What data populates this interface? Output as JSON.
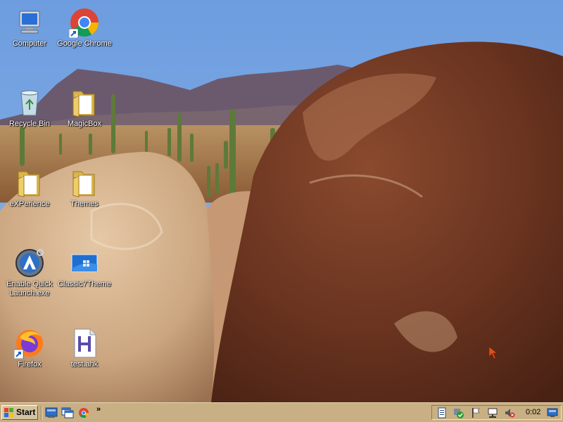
{
  "desktop": {
    "icons": [
      {
        "label": "Computer",
        "icon": "computer-icon"
      },
      {
        "label": "Google Chrome",
        "icon": "chrome-icon"
      },
      {
        "label": "Recycle Bin",
        "icon": "recycle-bin-icon"
      },
      {
        "label": "MagicBox",
        "icon": "folder-icon"
      },
      {
        "label": "eXPerience",
        "icon": "folder-icon"
      },
      {
        "label": "Themes",
        "icon": "folder-icon"
      },
      {
        "label": "Enable Quick\nLaunch.exe",
        "icon": "quick-launch-app-icon"
      },
      {
        "label": "Classic7Theme",
        "icon": "theme-icon"
      },
      {
        "label": "Firefox",
        "icon": "firefox-icon"
      },
      {
        "label": "test.ahk",
        "icon": "ahk-script-icon"
      }
    ]
  },
  "taskbar": {
    "start_label": "Start",
    "quick_launch": [
      "show-desktop-icon",
      "switch-windows-icon",
      "chrome-icon"
    ],
    "quick_launch_more": "»",
    "tray_icons": [
      "document-icon",
      "security-check-icon",
      "flag-icon",
      "network-icon",
      "volume-muted-icon",
      "display-icon"
    ],
    "clock": "0:02"
  },
  "colors": {
    "taskbar": "#c8b084",
    "sky": "#6f9ed8",
    "icon_label": "#ffffff"
  }
}
